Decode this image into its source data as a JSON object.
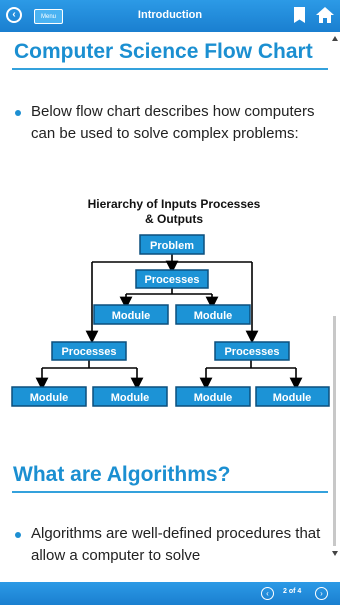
{
  "topbar": {
    "menu_label": "Menu",
    "title": "Introduction",
    "back_icon": "back-circle-icon",
    "bookmark_icon": "bookmark-icon",
    "home_icon": "home-icon"
  },
  "section1": {
    "heading": "Computer Science Flow Chart",
    "paragraph": "Below flow chart describes how computers can be used to solve complex problems:"
  },
  "flowchart": {
    "title_line1": "Hierarchy of Inputs Processes",
    "title_line2": "& Outputs",
    "problem": "Problem",
    "processes_top": "Processes",
    "module_mid_left": "Module",
    "module_mid_right": "Module",
    "processes_left": "Processes",
    "processes_right": "Processes",
    "module_b1": "Module",
    "module_b2": "Module",
    "module_b3": "Module",
    "module_b4": "Module",
    "box_color": "#1c93d6",
    "box_border": "#0b4f7d"
  },
  "section2": {
    "heading": "What are Algorithms?",
    "paragraph": "Algorithms are well-defined procedures that allow a computer to solve"
  },
  "bottombar": {
    "page_indicator": "2 of 4"
  },
  "colors": {
    "accent": "#1b8fd1",
    "bar": "#1f86d6"
  }
}
